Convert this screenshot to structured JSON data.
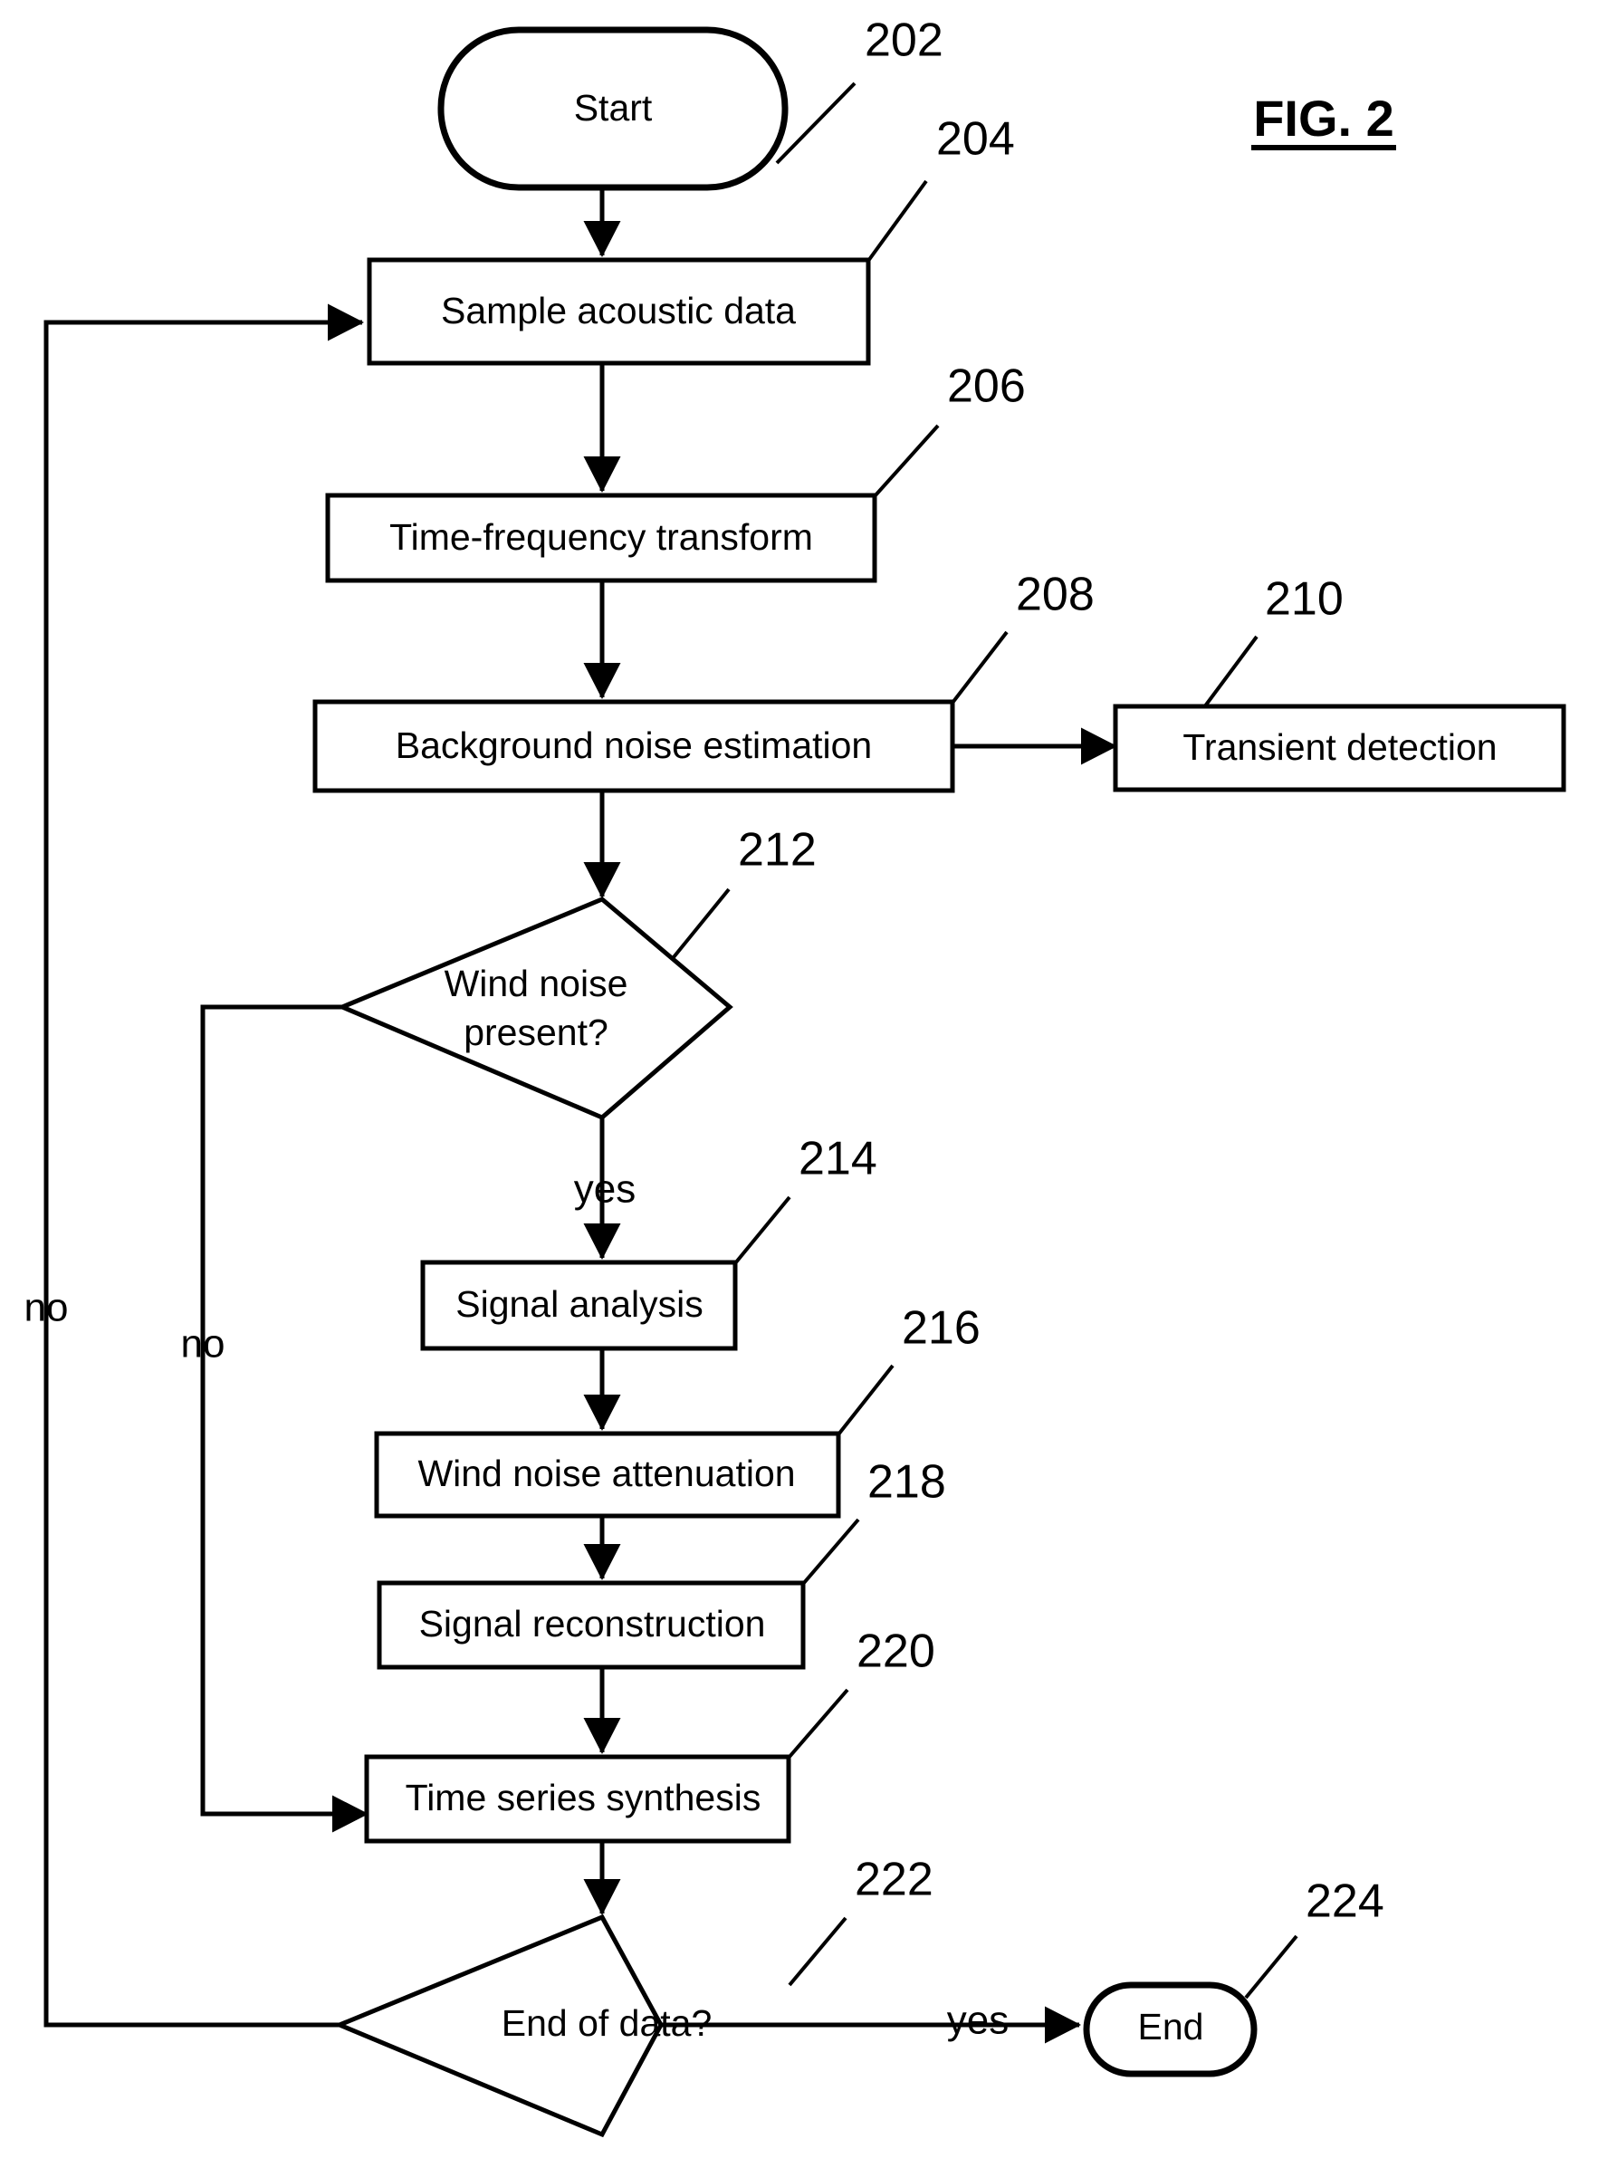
{
  "figure": {
    "label": "FIG. 2",
    "underline": true
  },
  "nodes": [
    {
      "id": "start",
      "ref": "202",
      "text": "Start",
      "shape": "terminator"
    },
    {
      "id": "sample",
      "ref": "204",
      "text": "Sample acoustic data",
      "shape": "process"
    },
    {
      "id": "tft",
      "ref": "206",
      "text": "Time-frequency transform",
      "shape": "process"
    },
    {
      "id": "bgnoise",
      "ref": "208",
      "text": "Background noise estimation",
      "shape": "process"
    },
    {
      "id": "transient",
      "ref": "210",
      "text": "Transient detection",
      "shape": "process"
    },
    {
      "id": "windq",
      "ref": "212",
      "text_line1": "Wind noise",
      "text_line2": "present?",
      "shape": "decision"
    },
    {
      "id": "siganal",
      "ref": "214",
      "text": "Signal analysis",
      "shape": "process"
    },
    {
      "id": "windatt",
      "ref": "216",
      "text": "Wind noise attenuation",
      "shape": "process"
    },
    {
      "id": "sigrecon",
      "ref": "218",
      "text": "Signal reconstruction",
      "shape": "process"
    },
    {
      "id": "tssynth",
      "ref": "220",
      "text": "Time series synthesis",
      "shape": "process"
    },
    {
      "id": "eodq",
      "ref": "222",
      "text": "End of data?",
      "shape": "decision"
    },
    {
      "id": "end",
      "ref": "224",
      "text": "End",
      "shape": "terminator"
    }
  ],
  "edge_labels": {
    "wind_yes": "yes",
    "wind_no": "no",
    "eod_yes": "yes",
    "eod_no": "no"
  },
  "colors": {
    "stroke": "#000000",
    "fill": "#ffffff",
    "background": "#ffffff"
  }
}
